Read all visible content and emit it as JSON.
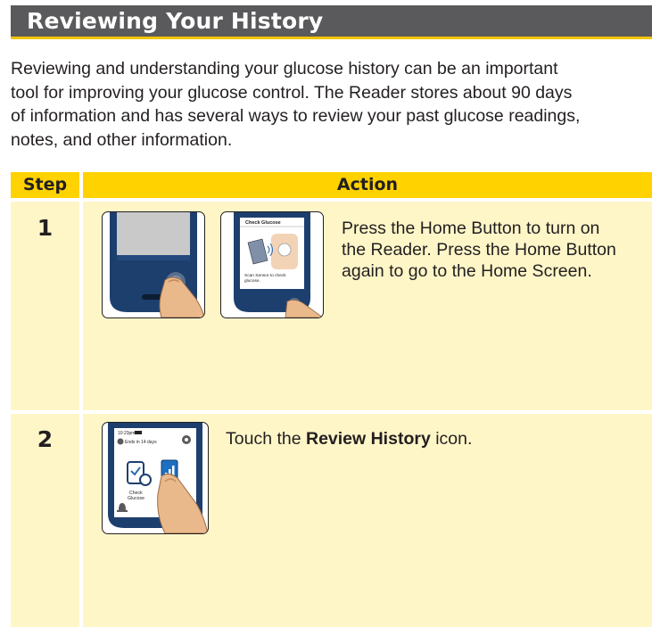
{
  "section": {
    "title": "Reviewing Your History"
  },
  "intro": {
    "lines": [
      "Reviewing and understanding your glucose history can be an important",
      "tool for improving your glucose control. The Reader stores about 90 days",
      "of information and has several ways to review your past glucose readings,",
      "notes, and other information."
    ]
  },
  "table": {
    "headers": {
      "step": "Step",
      "action": "Action"
    },
    "rows": [
      {
        "step": "1",
        "text_lines": [
          "Press the Home Button to turn on",
          "the Reader. Press the Home Button",
          "again to go to the Home Screen."
        ],
        "screen": {
          "title": "Check Glucose",
          "caption_line1": "Scan Sensor to check",
          "caption_line2": "glucose."
        }
      },
      {
        "step": "2",
        "text_before": "Touch the ",
        "text_bold": "Review History",
        "text_after": " icon.",
        "screen": {
          "time": "10:23pm",
          "sensor_status": "Ends in 14 days",
          "icon_label_line1": "Check",
          "icon_label_line2": "Glucose"
        }
      }
    ]
  },
  "colors": {
    "title_bar": "#5a5a5c",
    "accent_yellow": "#ffd200",
    "row_fill": "#fff6c8",
    "device_blue": "#1d3f6e"
  },
  "icons": [
    "reader-device-icon",
    "finger-press-icon",
    "sensor-scan-icon",
    "gear-icon",
    "alarm-bell-icon",
    "review-history-icon"
  ]
}
